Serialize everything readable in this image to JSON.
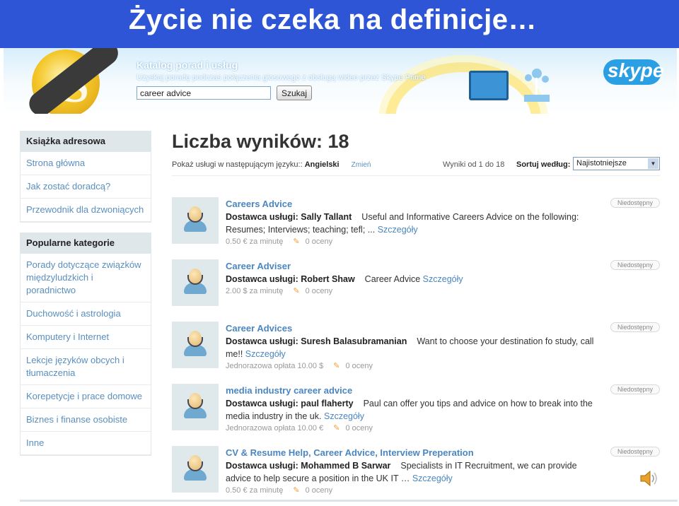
{
  "slide": {
    "title": "Życie nie czeka na definicje…"
  },
  "banner": {
    "title": "Katalog porad i usług",
    "subtitle": "Uzyskaj poradę podczas połączenia głosowego z obsługą wideo przez Skype Prime",
    "search_value": "career advice",
    "search_button": "Szukaj",
    "brand": "skype"
  },
  "sidebar": {
    "section1": {
      "heading": "Książka adresowa",
      "items": [
        {
          "label": "Strona główna"
        },
        {
          "label": "Jak zostać doradcą?"
        },
        {
          "label": "Przewodnik dla dzwoniących"
        }
      ]
    },
    "section2": {
      "heading": "Popularne kategorie",
      "items": [
        {
          "label": "Porady dotyczące związków międzyludzkich i poradnictwo"
        },
        {
          "label": "Duchowość i astrologia"
        },
        {
          "label": "Komputery i Internet"
        },
        {
          "label": "Lekcje języków obcych i tłumaczenia"
        },
        {
          "label": "Korepetycje i prace domowe"
        },
        {
          "label": "Biznes i finanse osobiste"
        },
        {
          "label": "Inne"
        }
      ]
    }
  },
  "main": {
    "results_title": "Liczba wyników: 18",
    "language_label": "Pokaż usługi w następującym języku:: ",
    "language_value": "Angielski",
    "change_link": "Zmień",
    "range_text": "Wyniki od 1 do 18",
    "sort_label": "Sortuj według:",
    "sort_value": "Najistotniejsze",
    "results": [
      {
        "title": "Careers Advice",
        "provider": "Dostawca usługi: Sally Tallant",
        "desc": "Useful and Informative Careers Advice on the following: Resumes; Interviews; teaching; tefl; ...",
        "more": "Szczegóły",
        "price": "0.50 € za minutę",
        "rating": "0 oceny",
        "status": "Niedostępny"
      },
      {
        "title": "Career Adviser",
        "provider": "Dostawca usługi: Robert Shaw",
        "desc": "Career Advice",
        "more": "Szczegóły",
        "price": "2.00 $ za minutę",
        "rating": "0 oceny",
        "status": "Niedostępny"
      },
      {
        "title": "Career Advices",
        "provider": "Dostawca usługi: Suresh Balasubramanian",
        "desc": "Want to choose your destination fo study, call me!!",
        "more": "Szczegóły",
        "price": "Jednorazowa opłata 10.00 $",
        "rating": "0 oceny",
        "status": "Niedostępny"
      },
      {
        "title": "media industry career advice",
        "provider": "Dostawca usługi: paul flaherty",
        "desc": "Paul can offer you tips and advice on how to break into the media industry in the uk.",
        "more": "Szczegóły",
        "price": "Jednorazowa opłata 10.00 €",
        "rating": "0 oceny",
        "status": "Niedostępny"
      },
      {
        "title": "CV & Resume Help, Career Advice, Interview Preperation",
        "provider": "Dostawca usługi: Mohammed B Sarwar",
        "desc": "Specialists in IT Recruitment, we can provide advice to help secure a position in the UK IT …",
        "more": "Szczegóły",
        "price": "0.50 € za minutę",
        "rating": "0 oceny",
        "status": "Niedostępny"
      }
    ]
  }
}
